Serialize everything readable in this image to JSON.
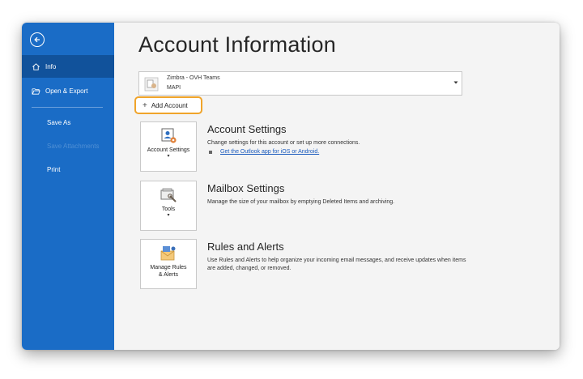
{
  "sidebar": {
    "back_icon": "back-arrow-icon",
    "items": [
      {
        "label": "Info",
        "icon": "home-icon",
        "active": true
      },
      {
        "label": "Open & Export",
        "icon": "folder-open-icon"
      }
    ],
    "secondary": [
      {
        "label": "Save As"
      },
      {
        "label": "Save Attachments",
        "disabled": true
      },
      {
        "label": "Print"
      }
    ]
  },
  "main": {
    "title": "Account Information",
    "account": {
      "name": "Zimbra - OVH Teams",
      "type": "MAPI"
    },
    "add_account_label": "Add Account",
    "sections": [
      {
        "tile_label": "Account Settings",
        "tile_icon": "account-settings-icon",
        "title": "Account Settings",
        "description": "Change settings for this account or set up more connections.",
        "link": "Get the Outlook app for iOS or Android."
      },
      {
        "tile_label": "Tools",
        "tile_icon": "tools-icon",
        "title": "Mailbox Settings",
        "description": "Manage the size of your mailbox by emptying Deleted Items and archiving."
      },
      {
        "tile_label_line1": "Manage Rules",
        "tile_label_line2": "& Alerts",
        "tile_icon": "rules-alerts-icon",
        "title": "Rules and Alerts",
        "description": "Use Rules and Alerts to help organize your incoming email messages, and receive updates when items are added, changed, or removed."
      }
    ]
  },
  "colors": {
    "sidebar": "#1a6cc6",
    "sidebar_active": "#11529b",
    "highlight": "#f0a42a",
    "link": "#1b5bbd"
  }
}
